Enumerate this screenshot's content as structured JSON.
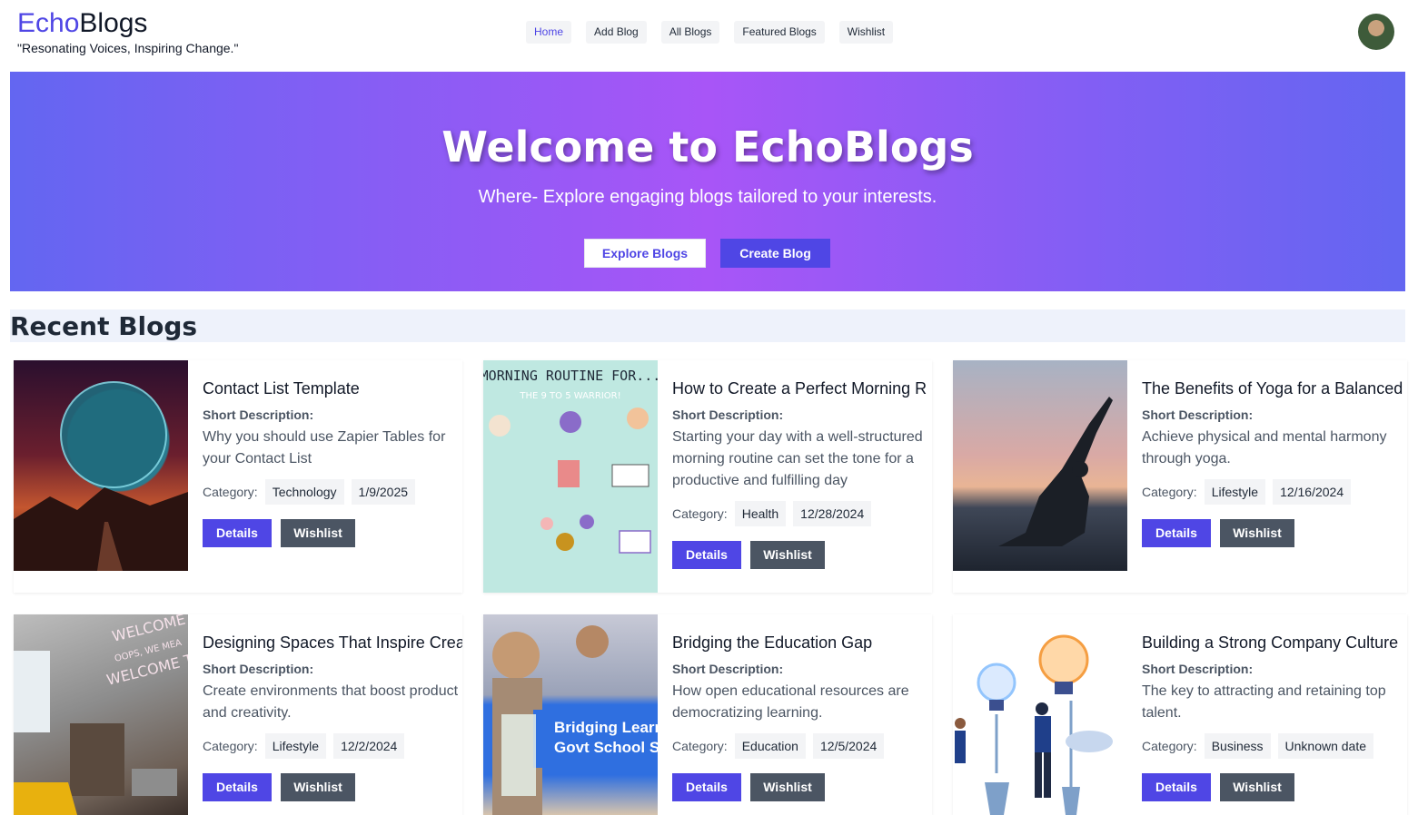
{
  "brand": {
    "prefix": "Echo",
    "suffix": "Blogs",
    "tagline": "\"Resonating Voices, Inspiring Change.\""
  },
  "nav": [
    {
      "label": "Home",
      "active": true
    },
    {
      "label": "Add Blog",
      "active": false
    },
    {
      "label": "All Blogs",
      "active": false
    },
    {
      "label": "Featured Blogs",
      "active": false
    },
    {
      "label": "Wishlist",
      "active": false
    }
  ],
  "hero": {
    "title": "Welcome to EchoBlogs",
    "subtitle": "Where- Explore engaging blogs tailored to your interests.",
    "explore_label": "Explore Blogs",
    "create_label": "Create Blog"
  },
  "section": {
    "title": "Recent Blogs"
  },
  "card_labels": {
    "short_desc": "Short Description:",
    "category": "Category:",
    "details": "Details",
    "wishlist": "Wishlist"
  },
  "blogs": [
    {
      "title": "Contact List Template",
      "description": "Why you should use Zapier Tables for your Contact List",
      "category": "Technology",
      "date": "1/9/2025"
    },
    {
      "title": "How to Create a Perfect Morning R",
      "description": "Starting your day with a well-structured morning routine can set the tone for a productive and fulfilling day",
      "category": "Health",
      "date": "12/28/2024"
    },
    {
      "title": "The Benefits of Yoga for a Balanced",
      "description": "Achieve physical and mental harmony through yoga.",
      "category": "Lifestyle",
      "date": "12/16/2024"
    },
    {
      "title": "Designing Spaces That Inspire Crea",
      "description": "Create environments that boost product and creativity.",
      "category": "Lifestyle",
      "date": "12/2/2024"
    },
    {
      "title": "Bridging the Education Gap",
      "description": "How open educational resources are democratizing learning.",
      "category": "Education",
      "date": "12/5/2024"
    },
    {
      "title": "Building a Strong Company Culture",
      "description": "The key to attracting and retaining top talent.",
      "category": "Business",
      "date": "Unknown date"
    }
  ],
  "thumbs": {
    "morning": {
      "title": "MORNING ROUTINE FOR...",
      "subtitle": "THE 9 TO 5 WARRIOR!"
    },
    "edu": {
      "banner_line1": "Bridging Learn",
      "banner_line2": "Govt School St"
    },
    "office": {
      "neon_line1": "WELCOME HO",
      "neon_line2": "OOPS, WE MEA",
      "neon_line3": "WELCOME TO"
    }
  }
}
